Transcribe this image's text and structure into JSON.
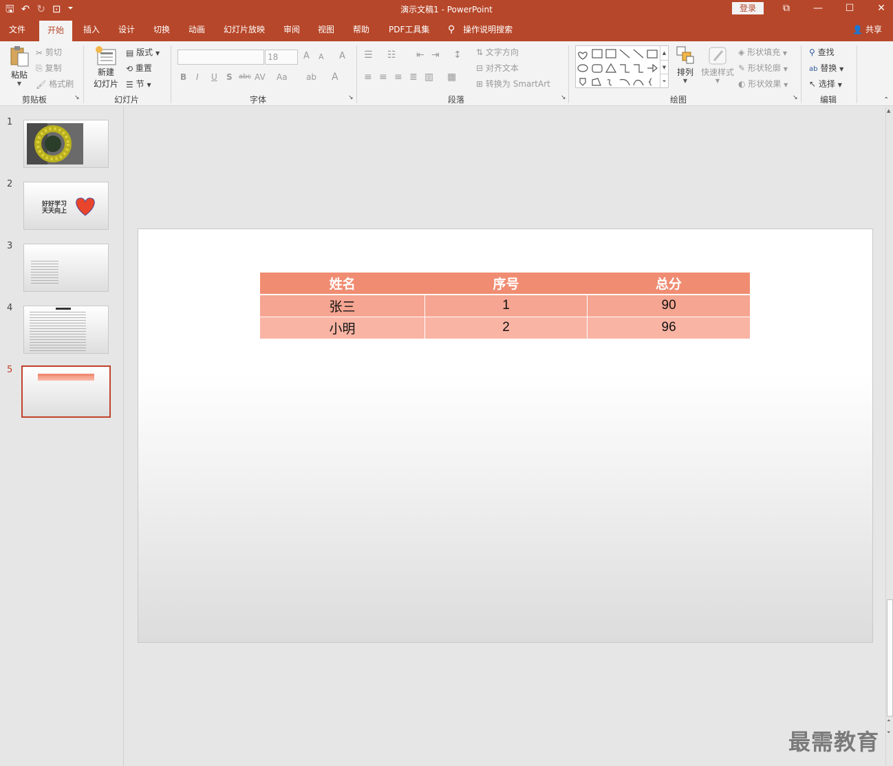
{
  "window": {
    "title": "演示文稿1 - PowerPoint",
    "login_label": "登录",
    "minimize": "—",
    "maximize": "☐",
    "close": "✕",
    "restore_icon": "⧉"
  },
  "qat": {
    "save": "🖫",
    "undo": "↶",
    "redo": "↻",
    "slideshow": "⊡",
    "more": "⏷"
  },
  "tabs": [
    "文件",
    "开始",
    "插入",
    "设计",
    "切换",
    "动画",
    "幻灯片放映",
    "审阅",
    "视图",
    "帮助",
    "PDF工具集"
  ],
  "tell_me": "操作说明搜索",
  "share": "共享",
  "ribbon": {
    "clipboard": {
      "label": "剪贴板",
      "paste": "粘贴",
      "cut": "剪切",
      "copy": "复制",
      "format_painter": "格式刷"
    },
    "slides": {
      "label": "幻灯片",
      "new_slide_1": "新建",
      "new_slide_2": "幻灯片",
      "layout": "版式",
      "reset": "重置",
      "section": "节"
    },
    "font": {
      "label": "字体",
      "font_name": "",
      "font_size": "18",
      "bold": "B",
      "italic": "I",
      "underline": "U",
      "shadow": "S",
      "strike": "abc",
      "spacing": "AV",
      "case": "Aa",
      "grow": "A",
      "shrink": "A",
      "clear": "A",
      "color": "A",
      "highlight": "ab"
    },
    "paragraph": {
      "label": "段落",
      "text_direction": "文字方向",
      "align_text": "对齐文本",
      "smartart": "转换为 SmartArt"
    },
    "drawing": {
      "label": "绘图",
      "arrange": "排列",
      "quick_styles": "快速样式",
      "shape_fill": "形状填充",
      "shape_outline": "形状轮廓",
      "shape_effects": "形状效果"
    },
    "editing": {
      "label": "编辑",
      "find": "查找",
      "replace": "替换",
      "select": "选择"
    }
  },
  "thumbnails": [
    {
      "num": "1"
    },
    {
      "num": "2",
      "text_line1": "好好学习",
      "text_line2": "天天向上"
    },
    {
      "num": "3"
    },
    {
      "num": "4"
    },
    {
      "num": "5"
    }
  ],
  "slide_table": {
    "headers": [
      "姓名",
      "序号",
      "总分"
    ],
    "rows": [
      [
        "张三",
        "1",
        "90"
      ],
      [
        "小明",
        "2",
        "96"
      ]
    ]
  },
  "watermark": "最需教育"
}
